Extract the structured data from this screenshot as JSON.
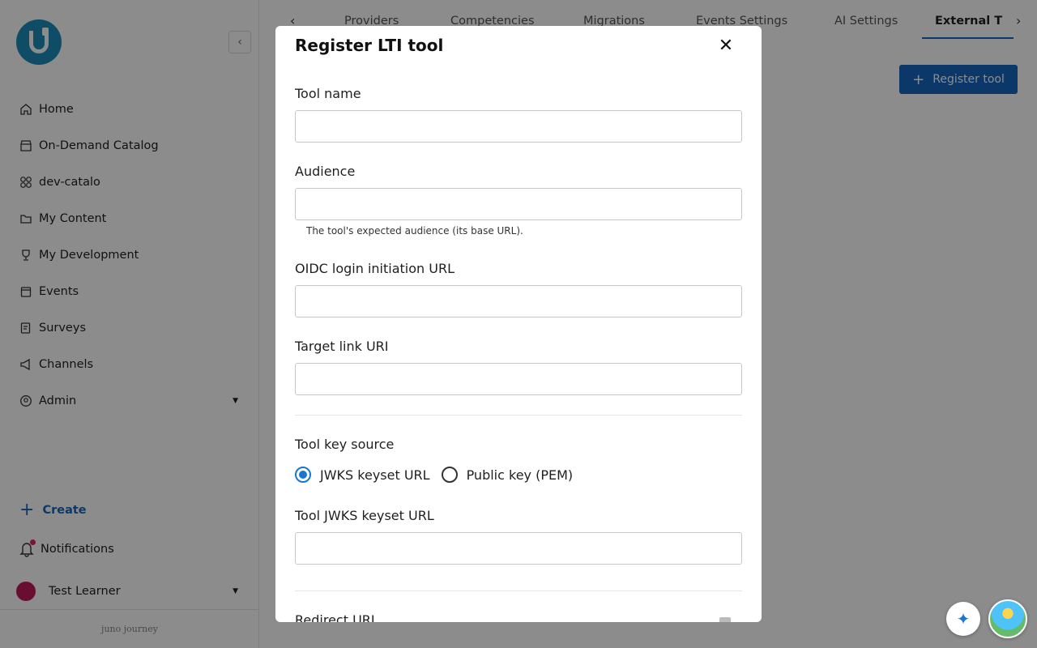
{
  "sidebar": {
    "items": [
      {
        "label": "Home",
        "icon": "home-icon"
      },
      {
        "label": "On-Demand Catalog",
        "icon": "store-icon"
      },
      {
        "label": "dev-catalo",
        "icon": "grid-icon"
      },
      {
        "label": "My Content",
        "icon": "folder-icon"
      },
      {
        "label": "My Development",
        "icon": "trophy-icon"
      },
      {
        "label": "Events",
        "icon": "calendar-icon"
      },
      {
        "label": "Surveys",
        "icon": "survey-icon"
      },
      {
        "label": "Channels",
        "icon": "megaphone-icon"
      },
      {
        "label": "Admin",
        "icon": "user-circle-icon"
      }
    ],
    "create_label": "Create",
    "notifications_label": "Notifications",
    "user_name": "Test Learner",
    "brand": "juno journey"
  },
  "tabs": [
    "Providers",
    "Competencies",
    "Migrations",
    "Events Settings",
    "AI Settings",
    "External T"
  ],
  "register_button": "Register tool",
  "modal": {
    "title": "Register LTI tool",
    "fields": {
      "tool_name": {
        "label": "Tool name",
        "value": ""
      },
      "audience": {
        "label": "Audience",
        "value": "",
        "helper": "The tool's expected audience (its base URL)."
      },
      "oidc": {
        "label": "OIDC login initiation URL",
        "value": ""
      },
      "target_link": {
        "label": "Target link URI",
        "value": ""
      },
      "key_source": {
        "label": "Tool key source",
        "options": [
          "JWKS keyset URL",
          "Public key (PEM)"
        ],
        "selected": "JWKS keyset URL"
      },
      "jwks": {
        "label": "Tool JWKS keyset URL",
        "value": ""
      },
      "redirect": {
        "label": "Redirect URL"
      }
    }
  },
  "colors": {
    "accent": "#1565c0",
    "radio": "#1976d2"
  }
}
